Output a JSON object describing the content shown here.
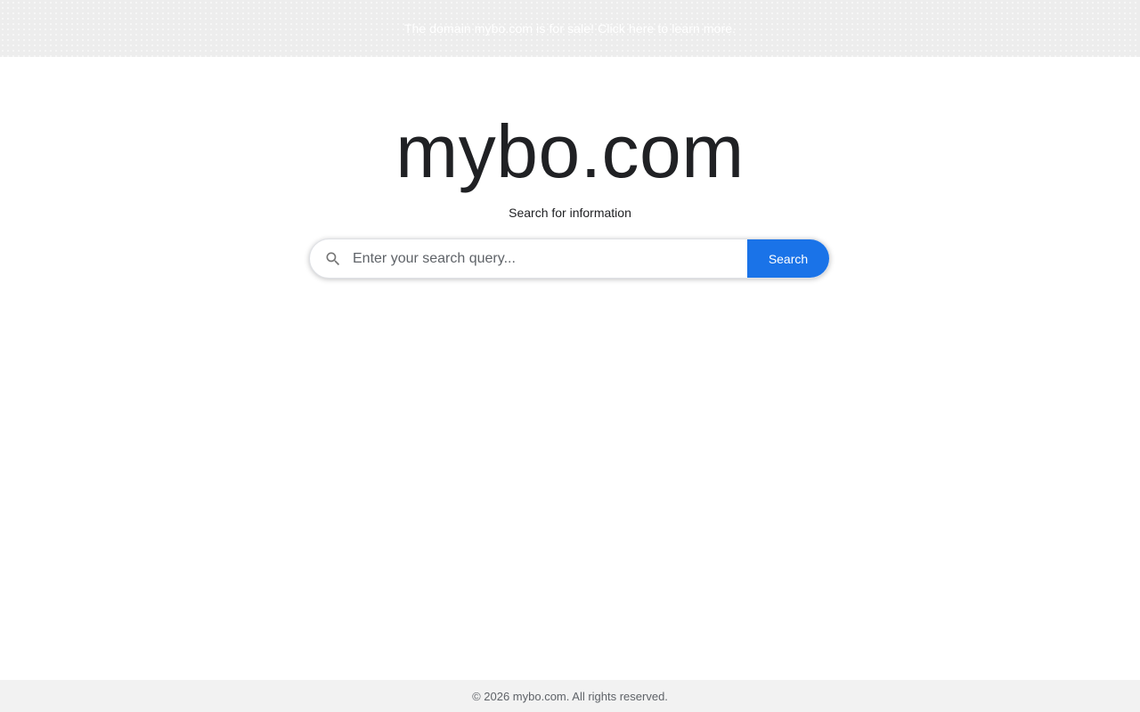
{
  "banner": {
    "text": "The domain mybo.com is for sale! Click here to learn more."
  },
  "header": {
    "title": "mybo.com",
    "subtitle": "Search for information"
  },
  "search": {
    "placeholder": "Enter your search query...",
    "value": "",
    "button_label": "Search",
    "icon": "search-icon"
  },
  "footer": {
    "text": "© 2026 mybo.com. All rights reserved."
  },
  "colors": {
    "accent": "#1a73e8",
    "banner_bg": "#ededed",
    "footer_bg": "#f2f2f2",
    "title_text": "#202124"
  }
}
